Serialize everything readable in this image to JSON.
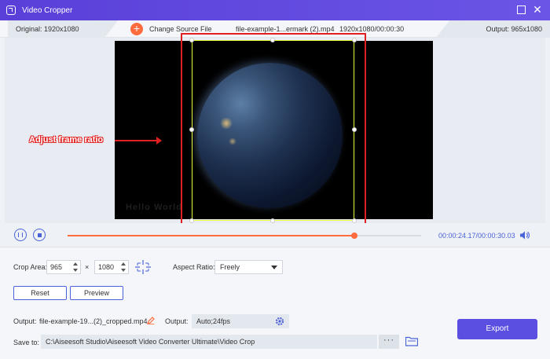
{
  "window": {
    "title": "Video Cropper"
  },
  "infobar": {
    "original": "Original: 1920x1080",
    "change_source": "Change Source File",
    "filename": "file-example-1...ermark (2).mp4",
    "resolution": "1920x1080/00:00:30",
    "output": "Output: 965x1080"
  },
  "preview": {
    "annotation": "Adjust frame ratio",
    "watermark": "Hello World"
  },
  "playback": {
    "time": "00:00:24.17/00:00:30.03",
    "progress_fraction": 0.81
  },
  "crop": {
    "label": "Crop Area:",
    "width": "965",
    "times": "×",
    "height": "1080",
    "aspect_label": "Aspect Ratio:",
    "aspect_value": "Freely",
    "reset": "Reset",
    "preview": "Preview"
  },
  "output": {
    "label": "Output:",
    "filename": "file-example-19...(2)_cropped.mp4",
    "settings_label": "Output:",
    "settings_value": "Auto;24fps",
    "save_label": "Save to:",
    "save_path": "C:\\Aiseesoft Studio\\Aiseesoft Video Converter Ultimate\\Video Crop",
    "dots": "···",
    "export": "Export"
  },
  "colors": {
    "accent": "#5a4fe0",
    "progress": "#ff6b3d",
    "annotation": "#e02020",
    "crop_frame": "#e6ff36"
  }
}
